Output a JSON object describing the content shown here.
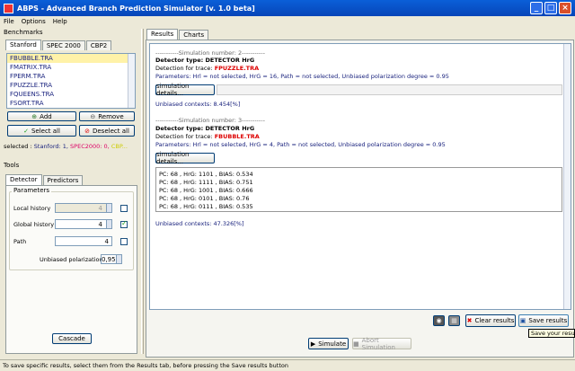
{
  "window": {
    "title": "ABPS - Advanced Branch Prediction Simulator [v. 1.0 beta]",
    "min": "_",
    "max": "□",
    "close": "×"
  },
  "menu": [
    "File",
    "Options",
    "Help"
  ],
  "benchmarks": {
    "label": "Benchmarks",
    "tabs": [
      "Stanford",
      "SPEC 2000",
      "CBP2"
    ],
    "items": [
      "FBUBBLE.TRA",
      "FMATRIX.TRA",
      "FPERM.TRA",
      "FPUZZLE.TRA",
      "FQUEENS.TRA",
      "FSORT.TRA"
    ],
    "add": "Add",
    "remove": "Remove",
    "select_all": "Select all",
    "deselect_all": "Deselect all",
    "selected_prefix": "selected :",
    "selected_main": "Stanford: 1,",
    "selected_spec": "SPEC2000: 0,",
    "selected_cbp": "CBP..."
  },
  "tools": {
    "label": "Tools",
    "tabs": [
      "Detector",
      "Predictors"
    ],
    "params_label": "Parameters",
    "local_history": {
      "label": "Local history",
      "value": "4"
    },
    "global_history": {
      "label": "Global history",
      "value": "4"
    },
    "path": {
      "label": "Path",
      "value": "4"
    },
    "unbiased": {
      "label": "Unbiased polarization",
      "value": "0,95"
    },
    "cascade": "Cascade"
  },
  "results": {
    "tabs": [
      "Results",
      "Charts"
    ],
    "sim2": {
      "header": "-----------Simulation number: 2-----------",
      "detector": "Detector type: DETECTOR HrG",
      "trace_label": "Detection for trace:",
      "trace": "FPUZZLE.TRA",
      "params": "Parameters: Hrl = not selected, HrG = 16, Path = not selected, Unbiased polarization degree = 0.95",
      "details": "simulation details...",
      "contexts": "Unbiased contexts: 8.454[%]"
    },
    "sim3": {
      "header": "-----------Simulation number: 3-----------",
      "detector": "Detector type: DETECTOR HrG",
      "trace_label": "Detection for trace:",
      "trace": "FBUBBLE.TRA",
      "params": "Parameters: Hrl = not selected, HrG = 4, Path = not selected, Unbiased polarization degree = 0.95",
      "details": "simulation details...",
      "rows": [
        "PC: 68 , HrG: 1101 , BIAS: 0.534",
        "PC: 68 , HrG: 1111 , BIAS: 0.751",
        "PC: 68 , HrG: 1001 , BIAS: 0.666",
        "PC: 68 , HrG: 0101 , BIAS: 0.76",
        "PC: 68 , HrG: 0111 , BIAS: 0.535"
      ],
      "contexts": "Unbiased contexts: 47.326[%]"
    },
    "clear": "Clear results",
    "save": "Save results",
    "tooltip": "Save your results",
    "simulate": "Simulate",
    "abort": "Abort Simulation"
  },
  "status": "To save specific results, select them from the Results tab, before pressing the Save results button"
}
